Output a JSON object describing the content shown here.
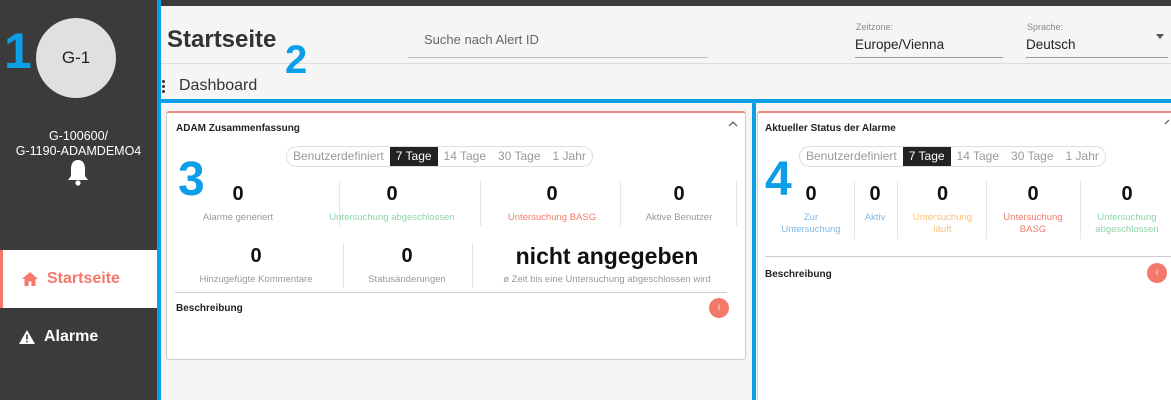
{
  "annotations": {
    "a1": "1",
    "a2": "2",
    "a3": "3",
    "a4": "4"
  },
  "sidebar": {
    "avatar_text": "G-1",
    "user_line1": "G-100600/",
    "user_line2": "G-1190-ADAMDEMO4",
    "bell_icon": "bell-icon",
    "items": [
      {
        "label": "Startseite",
        "icon": "home-icon",
        "active": true
      },
      {
        "label": "Alarme",
        "icon": "warning-icon",
        "active": false
      }
    ]
  },
  "header": {
    "title": "Startseite",
    "search_placeholder": "Suche nach Alert ID",
    "timezone_label": "Zeitzone:",
    "timezone_value": "Europe/Vienna",
    "language_label": "Sprache:",
    "language_value": "Deutsch"
  },
  "dashboard": {
    "label": "Dashboard"
  },
  "card_summary": {
    "title": "ADAM Zusammenfassung",
    "ranges": [
      "Benutzerdefiniert",
      "7 Tage",
      "14 Tage",
      "30 Tage",
      "1 Jahr"
    ],
    "active_range": "7 Tage",
    "row1": [
      {
        "value": "0",
        "caption": "Alarme generiert",
        "color": "#999999"
      },
      {
        "value": "0",
        "caption": "Untersuchung abgeschlossen",
        "color": "#8fd3a8"
      },
      {
        "value": "0",
        "caption": "Untersuchung BASG",
        "color": "#f4796b"
      },
      {
        "value": "0",
        "caption": "Aktive Benutzer",
        "color": "#999999"
      }
    ],
    "row2": [
      {
        "value": "0",
        "caption": "Hinzugefügte Kommentare"
      },
      {
        "value": "0",
        "caption": "Statusänderungen"
      },
      {
        "value": "nicht angegeben",
        "caption": "ø Zeit bis eine Untersuchung abgeschlossen wird"
      }
    ],
    "description": "Beschreibung",
    "info_icon": "info-icon"
  },
  "card_status": {
    "title": "Aktueller Status der Alarme",
    "ranges": [
      "Benutzerdefiniert",
      "7 Tage",
      "14 Tage",
      "30 Tage",
      "1 Jahr"
    ],
    "active_range": "7 Tage",
    "stats": [
      {
        "value": "0",
        "caption_line1": "Zur",
        "caption_line2": "Untersuchung",
        "color": "#7fb7e8"
      },
      {
        "value": "0",
        "caption_line1": "Aktiv",
        "caption_line2": "",
        "color": "#7fb7e8"
      },
      {
        "value": "0",
        "caption_line1": "Untersuchung",
        "caption_line2": "läuft",
        "color": "#f7c27a"
      },
      {
        "value": "0",
        "caption_line1": "Untersuchung",
        "caption_line2": "BASG",
        "color": "#f4796b"
      },
      {
        "value": "0",
        "caption_line1": "Untersuchung",
        "caption_line2": "abgeschlossen",
        "color": "#8fd3a8"
      }
    ],
    "description": "Beschreibung",
    "info_icon": "info-icon"
  },
  "colors": {
    "accent": "#f4796b",
    "annotation_blue": "#0d9ee8",
    "sidebar_bg": "#3b3b3b"
  }
}
